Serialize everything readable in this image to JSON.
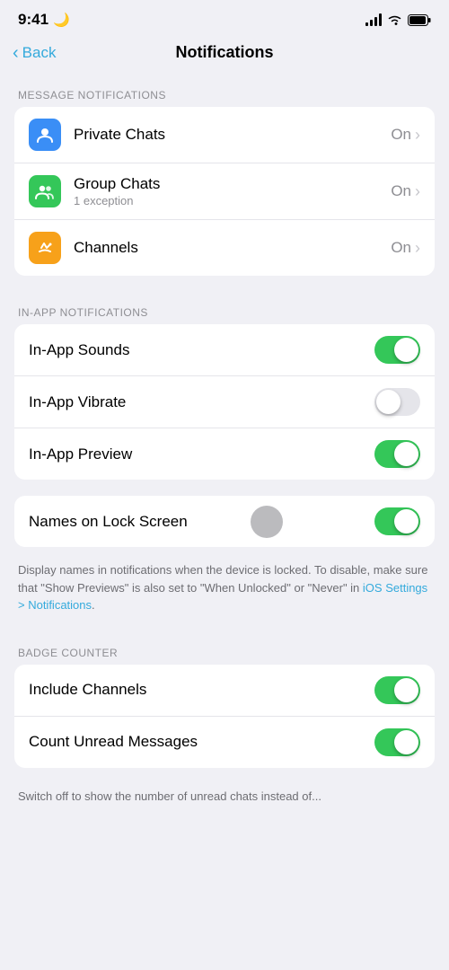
{
  "statusBar": {
    "time": "9:41",
    "moonIcon": "🌙"
  },
  "header": {
    "backLabel": "Back",
    "title": "Notifications"
  },
  "messageNotifications": {
    "sectionLabel": "MESSAGE NOTIFICATIONS",
    "items": [
      {
        "id": "private-chats",
        "label": "Private Chats",
        "subtitle": "",
        "status": "On",
        "iconColor": "blue"
      },
      {
        "id": "group-chats",
        "label": "Group Chats",
        "subtitle": "1 exception",
        "status": "On",
        "iconColor": "green"
      },
      {
        "id": "channels",
        "label": "Channels",
        "subtitle": "",
        "status": "On",
        "iconColor": "orange"
      }
    ]
  },
  "inAppNotifications": {
    "sectionLabel": "IN-APP NOTIFICATIONS",
    "items": [
      {
        "id": "in-app-sounds",
        "label": "In-App Sounds",
        "toggleOn": true
      },
      {
        "id": "in-app-vibrate",
        "label": "In-App Vibrate",
        "toggleOn": false
      },
      {
        "id": "in-app-preview",
        "label": "In-App Preview",
        "toggleOn": true
      }
    ]
  },
  "lockScreen": {
    "label": "Names on Lock Screen",
    "toggleOn": true,
    "description": "Display names in notifications when the device is locked. To disable, make sure that \"Show Previews\" is also set to \"When Unlocked\" or \"Never\" in ",
    "descriptionLink": "iOS Settings > Notifications",
    "descriptionEnd": "."
  },
  "badgeCounter": {
    "sectionLabel": "BADGE COUNTER",
    "items": [
      {
        "id": "include-channels",
        "label": "Include Channels",
        "toggleOn": true
      },
      {
        "id": "count-unread",
        "label": "Count Unread Messages",
        "toggleOn": true
      }
    ]
  },
  "bottomNote": "Switch off to show the number of unread chats instead of..."
}
